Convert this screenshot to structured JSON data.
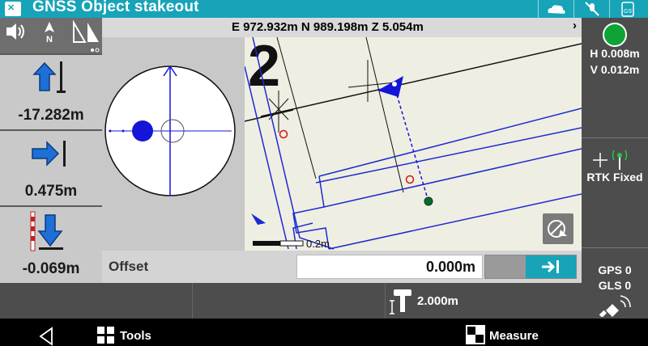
{
  "app": {
    "title": "GNSS Object stakeout",
    "app_icon": "map-app-icon"
  },
  "titlebar_icons": [
    "cloud-sync-icon",
    "mute-icon",
    "sd-card-icon"
  ],
  "coordinates": {
    "text": "E 972.932m N 989.198m Z 5.054m"
  },
  "left_panel": {
    "icons": [
      "volume-icon",
      "north-icon",
      "mirror-icon"
    ],
    "forward_value": "-17.282m",
    "right_value": "0.475m",
    "cut_value": "-0.069m"
  },
  "map": {
    "grid_label": "2",
    "scale_label": "0.2m"
  },
  "offset": {
    "label": "Offset",
    "value": "0.000m"
  },
  "right_panel": {
    "precision_h": "H 0.008m",
    "precision_v": "V 0.012m",
    "fix_status": "RTK Fixed",
    "gps_count": "GPS 0",
    "gls_count": "GLS 0"
  },
  "status_bar": {
    "antenna_height": "2.000m"
  },
  "nav": {
    "tools_label": "Tools",
    "measure_label": "Measure"
  },
  "colors": {
    "accent": "#17a3b8",
    "fix_green": "#0fa336",
    "target_blue": "#1515d8"
  }
}
